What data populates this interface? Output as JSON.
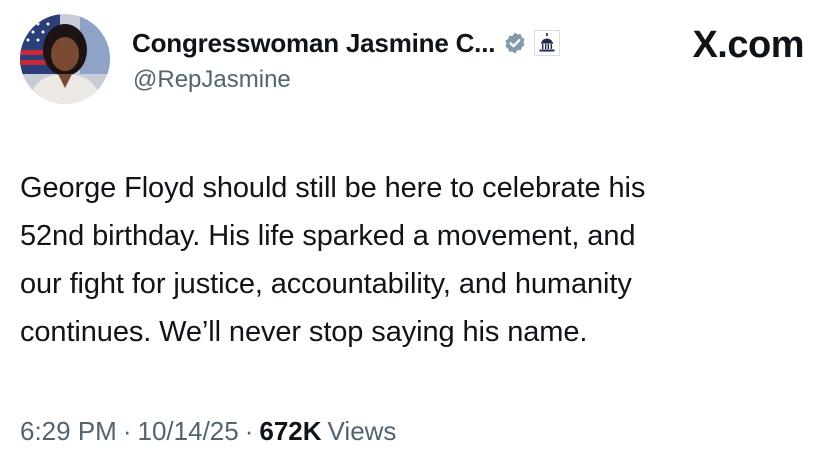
{
  "author": {
    "display_name": "Congresswoman Jasmine C...",
    "handle": "@RepJasmine"
  },
  "source_label": "X.com",
  "post": {
    "lines": [
      "George Floyd should still be here to celebrate his",
      "52nd birthday. His life sparked a movement, and",
      "our fight for justice, accountability, and humanity",
      "continues. We’ll never stop saying his name."
    ]
  },
  "meta": {
    "time": "6:29 PM",
    "separator": "·",
    "date": "10/14/25",
    "views_count": "672K",
    "views_label": "Views"
  },
  "colors": {
    "text_primary": "#0f1419",
    "text_secondary": "#536471",
    "verified_badge": "#829aab"
  },
  "icons": {
    "verified": "verified-badge-icon",
    "affiliation": "capitol-affiliation-icon"
  }
}
